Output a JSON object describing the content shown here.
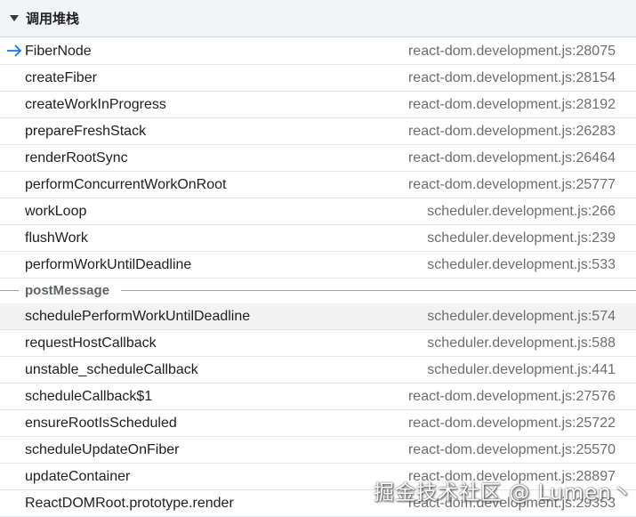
{
  "header": {
    "title": "调用堆栈"
  },
  "frames_top": [
    {
      "fn": "FiberNode",
      "loc": "react-dom.development.js:28075"
    },
    {
      "fn": "createFiber",
      "loc": "react-dom.development.js:28154"
    },
    {
      "fn": "createWorkInProgress",
      "loc": "react-dom.development.js:28192"
    },
    {
      "fn": "prepareFreshStack",
      "loc": "react-dom.development.js:26283"
    },
    {
      "fn": "renderRootSync",
      "loc": "react-dom.development.js:26464"
    },
    {
      "fn": "performConcurrentWorkOnRoot",
      "loc": "react-dom.development.js:25777"
    },
    {
      "fn": "workLoop",
      "loc": "scheduler.development.js:266"
    },
    {
      "fn": "flushWork",
      "loc": "scheduler.development.js:239"
    },
    {
      "fn": "performWorkUntilDeadline",
      "loc": "scheduler.development.js:533"
    }
  ],
  "async_separator": "postMessage",
  "frames_bottom": [
    {
      "fn": "schedulePerformWorkUntilDeadline",
      "loc": "scheduler.development.js:574"
    },
    {
      "fn": "requestHostCallback",
      "loc": "scheduler.development.js:588"
    },
    {
      "fn": "unstable_scheduleCallback",
      "loc": "scheduler.development.js:441"
    },
    {
      "fn": "scheduleCallback$1",
      "loc": "react-dom.development.js:27576"
    },
    {
      "fn": "ensureRootIsScheduled",
      "loc": "react-dom.development.js:25722"
    },
    {
      "fn": "scheduleUpdateOnFiber",
      "loc": "react-dom.development.js:25570"
    },
    {
      "fn": "updateContainer",
      "loc": "react-dom.development.js:28897"
    },
    {
      "fn": "ReactDOMRoot.prototype.render",
      "loc": "react-dom.development.js:29353"
    }
  ],
  "watermark": "掘金技术社区 @ Lumen丶",
  "colors": {
    "current_frame_arrow": "#1a73e8",
    "hover_row": "#f2f2f2"
  },
  "icons": {
    "current_frame": "arrow-right-icon",
    "toggle": "triangle-down-icon"
  }
}
